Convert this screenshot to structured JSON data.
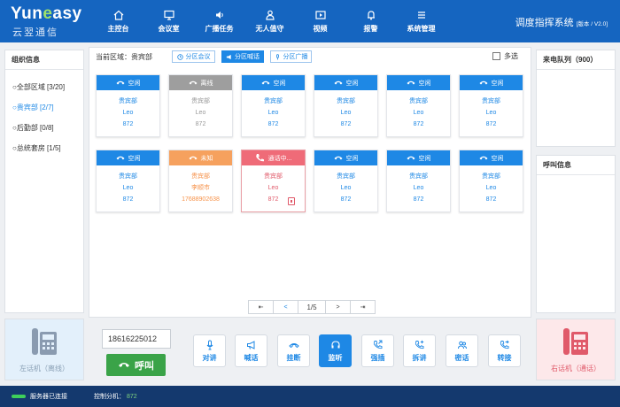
{
  "brand": {
    "logo_en_1": "Yun",
    "logo_en_2": "e",
    "logo_en_3": "asy",
    "logo_cn": "云翌通信"
  },
  "nav": [
    {
      "label": "主控台",
      "icon": "home-icon"
    },
    {
      "label": "会议室",
      "icon": "monitor-icon"
    },
    {
      "label": "广播任务",
      "icon": "speaker-icon"
    },
    {
      "label": "无人值守",
      "icon": "person-icon"
    },
    {
      "label": "视频",
      "icon": "video-camera-icon"
    },
    {
      "label": "报警",
      "icon": "bell-icon"
    },
    {
      "label": "系统管理",
      "icon": "menu-icon"
    }
  ],
  "system": {
    "title": "调度指挥系统",
    "version": "[版本 / V2.0]"
  },
  "org": {
    "title": "组织信息",
    "items": [
      {
        "label": "○全部区域 [3/20]",
        "active": false
      },
      {
        "label": "○贵宾部 [2/7]",
        "active": true
      },
      {
        "label": "○后勤部 [0/8]",
        "active": false
      },
      {
        "label": "○总统套房 [1/5]",
        "active": false
      }
    ]
  },
  "toolbar": {
    "area_label": "当前区域：贵宾部",
    "buttons": [
      {
        "label": "分区会议",
        "icon": "clock-icon",
        "active": false
      },
      {
        "label": "分区喊话",
        "icon": "megaphone-icon",
        "active": true
      },
      {
        "label": "分区广播",
        "icon": "mic-icon",
        "active": false
      }
    ],
    "multi_select": "多选"
  },
  "status_colors": {
    "空闲": "#1e88e5",
    "离线": "#9e9e9e",
    "未知": "#f6a15e",
    "通话中": "#ef6b78"
  },
  "cards": [
    {
      "status": "空闲",
      "lines": [
        "贵宾部",
        "Leo",
        "872"
      ]
    },
    {
      "status": "离线",
      "lines": [
        "贵宾部",
        "Leo",
        "872"
      ]
    },
    {
      "status": "空闲",
      "lines": [
        "贵宾部",
        "Leo",
        "872"
      ]
    },
    {
      "status": "空闲",
      "lines": [
        "贵宾部",
        "Leo",
        "872"
      ]
    },
    {
      "status": "空闲",
      "lines": [
        "贵宾部",
        "Leo",
        "872"
      ]
    },
    {
      "status": "空闲",
      "lines": [
        "贵宾部",
        "Leo",
        "872"
      ]
    },
    {
      "status": "空闲",
      "lines": [
        "贵宾部",
        "Leo",
        "872"
      ]
    },
    {
      "status": "未知",
      "lines": [
        "贵宾部",
        "李顺市",
        "17688902638"
      ]
    },
    {
      "status": "通话中...",
      "lines": [
        "贵宾部",
        "Leo",
        "872"
      ]
    },
    {
      "status": "空闲",
      "lines": [
        "贵宾部",
        "Leo",
        "872"
      ]
    },
    {
      "status": "空闲",
      "lines": [
        "贵宾部",
        "Leo",
        "872"
      ]
    },
    {
      "status": "空闲",
      "lines": [
        "贵宾部",
        "Leo",
        "872"
      ]
    }
  ],
  "pager": {
    "first": "⇤",
    "prev": "<",
    "page": "1/5",
    "next": ">",
    "last": "⇥"
  },
  "queue": {
    "title": "来电队列（900）"
  },
  "call_info": {
    "title": "呼叫信息"
  },
  "console": {
    "left_phone": "左话机（离线）",
    "right_phone": "右话机（通话）",
    "number_value": "18616225012",
    "call_label": "呼叫",
    "actions": [
      {
        "label": "对讲",
        "icon": "mic-icon",
        "active": false
      },
      {
        "label": "喊话",
        "icon": "megaphone-icon",
        "active": false
      },
      {
        "label": "挂断",
        "icon": "hangup-icon",
        "active": false
      },
      {
        "label": "监听",
        "icon": "headset-icon",
        "active": true
      },
      {
        "label": "强插",
        "icon": "phone-forward-icon",
        "active": false
      },
      {
        "label": "拆讲",
        "icon": "phone-add-icon",
        "active": false
      },
      {
        "label": "密话",
        "icon": "users-icon",
        "active": false
      },
      {
        "label": "转接",
        "icon": "phone-transfer-icon",
        "active": false
      }
    ]
  },
  "statusbar": {
    "server": "服务器已连接",
    "extension_label": "控制分机：",
    "extension_value": "872"
  }
}
